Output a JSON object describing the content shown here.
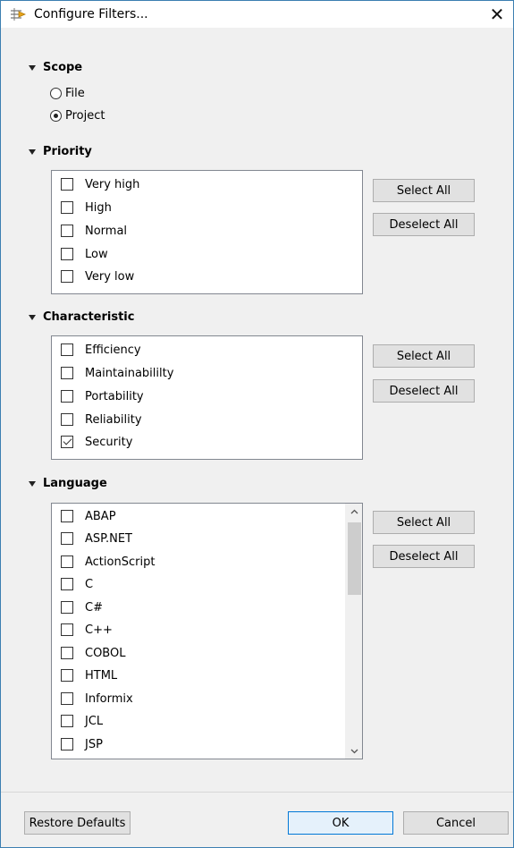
{
  "dialog": {
    "title": "Configure Filters...",
    "close_label": "✕"
  },
  "scope": {
    "header": "Scope",
    "options": [
      {
        "label": "File",
        "selected": false
      },
      {
        "label": "Project",
        "selected": true
      }
    ]
  },
  "priority": {
    "header": "Priority",
    "items": [
      {
        "label": "Very high",
        "checked": false
      },
      {
        "label": "High",
        "checked": false
      },
      {
        "label": "Normal",
        "checked": false
      },
      {
        "label": "Low",
        "checked": false
      },
      {
        "label": "Very low",
        "checked": false
      }
    ],
    "select_all": "Select All",
    "deselect_all": "Deselect All"
  },
  "characteristic": {
    "header": "Characteristic",
    "items": [
      {
        "label": "Efficiency",
        "checked": false
      },
      {
        "label": "Maintainabililty",
        "checked": false
      },
      {
        "label": "Portability",
        "checked": false
      },
      {
        "label": "Reliability",
        "checked": false
      },
      {
        "label": "Security",
        "checked": true
      }
    ],
    "select_all": "Select All",
    "deselect_all": "Deselect All"
  },
  "language": {
    "header": "Language",
    "items": [
      {
        "label": "ABAP",
        "checked": false
      },
      {
        "label": "ASP.NET",
        "checked": false
      },
      {
        "label": "ActionScript",
        "checked": false
      },
      {
        "label": "C",
        "checked": false
      },
      {
        "label": "C#",
        "checked": false
      },
      {
        "label": "C++",
        "checked": false
      },
      {
        "label": "COBOL",
        "checked": false
      },
      {
        "label": "HTML",
        "checked": false
      },
      {
        "label": "Informix",
        "checked": false
      },
      {
        "label": "JCL",
        "checked": false
      },
      {
        "label": "JSP",
        "checked": false
      }
    ],
    "select_all": "Select All",
    "deselect_all": "Deselect All",
    "scroll_up_icon": "chevron-up-icon",
    "scroll_down_icon": "chevron-down-icon"
  },
  "footer": {
    "restore_defaults": "Restore Defaults",
    "ok": "OK",
    "cancel": "Cancel"
  },
  "colors": {
    "window_border": "#3c7fb1",
    "dialog_bg": "#f0f0f0",
    "default_button_border": "#0078d7"
  }
}
